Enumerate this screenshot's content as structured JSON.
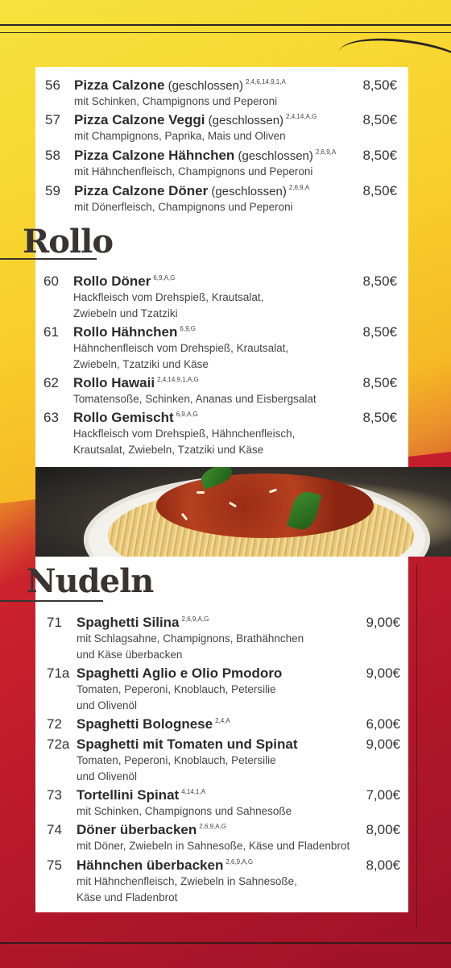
{
  "pizza": {
    "items": [
      {
        "num": "56",
        "name": "Pizza Calzone",
        "paren": "(geschlossen)",
        "codes": "2,4,6,14,9,1,A",
        "price": "8,50€",
        "desc": [
          "mit Schinken, Champignons und Peperoni"
        ]
      },
      {
        "num": "57",
        "name": "Pizza Calzone Veggi",
        "paren": "(geschlossen)",
        "codes": "2,4,14,A,G",
        "price": "8,50€",
        "desc": [
          "mit Champignons, Paprika, Mais und Oliven"
        ]
      },
      {
        "num": "58",
        "name": "Pizza Calzone Hähnchen",
        "paren": "(geschlossen)",
        "codes": "2,6,9,A",
        "price": "8,50€",
        "desc": [
          "mit Hähnchenfleisch, Champignons und Peperoni"
        ]
      },
      {
        "num": "59",
        "name": "Pizza Calzone Döner",
        "paren": "(geschlossen)",
        "codes": "2,6,9,A",
        "price": "8,50€",
        "desc": [
          "mit Dönerfleisch, Champignons und Peperoni"
        ]
      }
    ]
  },
  "rollo": {
    "title": "Rollo",
    "items": [
      {
        "num": "60",
        "name": "Rollo Döner",
        "codes": "6,9,A,G",
        "price": "8,50€",
        "desc": [
          "Hackfleisch vom Drehspieß, Krautsalat,",
          "Zwiebeln und Tzatziki"
        ]
      },
      {
        "num": "61",
        "name": "Rollo Hähnchen",
        "codes": "6,9,G",
        "price": "8,50€",
        "desc": [
          "Hähnchenfleisch vom Drehspieß, Krautsalat,",
          "Zwiebeln, Tzatziki und Käse"
        ]
      },
      {
        "num": "62",
        "name": "Rollo Hawaii",
        "codes": "2,4,14,9,1,A,G",
        "price": "8,50€",
        "desc": [
          "Tomatensoße, Schinken, Ananas und Eisbergsalat"
        ]
      },
      {
        "num": "63",
        "name": "Rollo Gemischt",
        "codes": "6,9,A,G",
        "price": "8,50€",
        "desc": [
          "Hackfleisch vom Drehspieß, Hähnchenfleisch,",
          "Krautsalat, Zwiebeln, Tzatziki und Käse"
        ]
      }
    ]
  },
  "nudeln": {
    "title": "Nudeln",
    "items": [
      {
        "num": "71",
        "name": "Spaghetti Silina",
        "codes": "2,6,9,A,G",
        "price": "9,00€",
        "desc": [
          "mit Schlagsahne, Champignons, Brathähnchen",
          "und Käse überbacken"
        ]
      },
      {
        "num": "71a",
        "name": "Spaghetti Aglio e Olio Pmodoro",
        "codes": "",
        "price": "9,00€",
        "desc": [
          "Tomaten, Peperoni, Knoblauch, Petersilie",
          "und Olivenöl"
        ]
      },
      {
        "num": "72",
        "name": "Spaghetti Bolognese",
        "codes": "2,4,A",
        "price": "6,00€",
        "desc": []
      },
      {
        "num": "72a",
        "name": "Spaghetti mit Tomaten und Spinat",
        "codes": "",
        "price": "9,00€",
        "desc": [
          "Tomaten, Peperoni, Knoblauch, Petersilie",
          "und Olivenöl"
        ]
      },
      {
        "num": "73",
        "name": "Tortellini Spinat",
        "codes": "4,14,1,A",
        "price": "7,00€",
        "desc": [
          "mit Schinken, Champignons und Sahnesoße"
        ]
      },
      {
        "num": "74",
        "name": "Döner überbacken",
        "codes": "2,6,9,A,G",
        "price": "8,00€",
        "desc": [
          "mit Döner, Zwiebeln in Sahnesoße, Käse und Fladenbrot"
        ]
      },
      {
        "num": "75",
        "name": "Hähnchen überbacken",
        "codes": "2,6,9,A,G",
        "price": "8,00€",
        "desc": [
          "mit Hähnchenfleisch, Zwiebeln in Sahnesoße,",
          "Käse und Fladenbrot"
        ]
      }
    ]
  },
  "colors": {
    "card": "#ffffff",
    "text": "#2b2b2b",
    "accent_yellow": "#f8cf2a",
    "accent_red": "#b8172a"
  }
}
